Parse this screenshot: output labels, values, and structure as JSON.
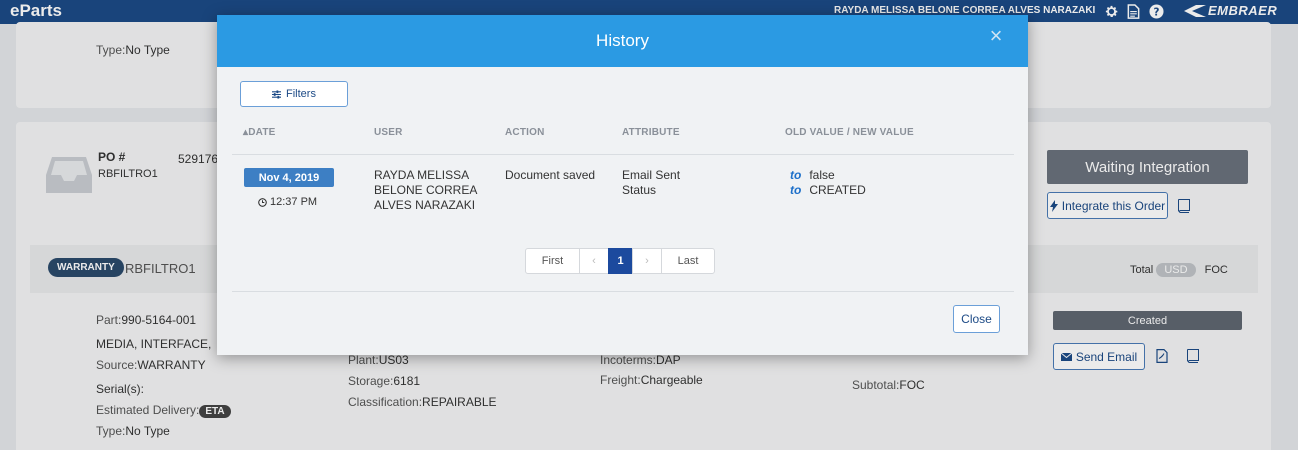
{
  "app": {
    "brand": "eParts",
    "user_name": "RAYDA MELISSA BELONE CORREA ALVES NARAZAKI",
    "logo_text": "EMBRAER"
  },
  "background": {
    "top_card": {
      "type_label": "Type:",
      "type_value": "No Type"
    },
    "order": {
      "po_label": "PO #",
      "po_number": "529176",
      "po_ref": "RBFILTRO1",
      "status_button": "Waiting Integration",
      "integrate_button": "Integrate this Order"
    },
    "item": {
      "badge": "WARRANTY",
      "ref": "RBFILTRO1",
      "total_label": "Total",
      "currency": "USD",
      "total_value": "FOC",
      "part_label": "Part:",
      "part_value": "990-5164-001",
      "description": "MEDIA, INTERFACE,",
      "source_label": "Source:",
      "source_value": "WARRANTY",
      "serial_label": "Serial(s):",
      "estimated_label": "Estimated Delivery:",
      "eta_badge": "ETA",
      "type_label": "Type:",
      "type_value": "No Type",
      "plant_label": "Plant:",
      "plant_value": "US03",
      "storage_label": "Storage:",
      "storage_value": "6181",
      "classification_label": "Classification:",
      "classification_value": "REPAIRABLE",
      "incoterms_label": "Incoterms:",
      "incoterms_value": "DAP",
      "freight_label": "Freight:",
      "freight_value": "Chargeable",
      "subtotal_label": "Subtotal:",
      "subtotal_value": "FOC",
      "status_badge": "Created",
      "send_email_button": "Send Email"
    }
  },
  "modal": {
    "title": "History",
    "filters_button": "Filters",
    "columns": {
      "date": "DATE",
      "user": "USER",
      "action": "ACTION",
      "attribute": "ATTRIBUTE",
      "values": "OLD VALUE / NEW VALUE"
    },
    "row": {
      "date": "Nov 4, 2019",
      "time": "12:37 PM",
      "user_lines": [
        "RAYDA MELISSA",
        "BELONE CORREA",
        "ALVES NARAZAKI"
      ],
      "action": "Document saved",
      "attributes": [
        "Email Sent",
        "Status"
      ],
      "to_word": "to",
      "new_values": [
        "false",
        "CREATED"
      ]
    },
    "pagination": {
      "first": "First",
      "prev": "‹",
      "current": "1",
      "next": "›",
      "last": "Last"
    },
    "close_button": "Close"
  }
}
